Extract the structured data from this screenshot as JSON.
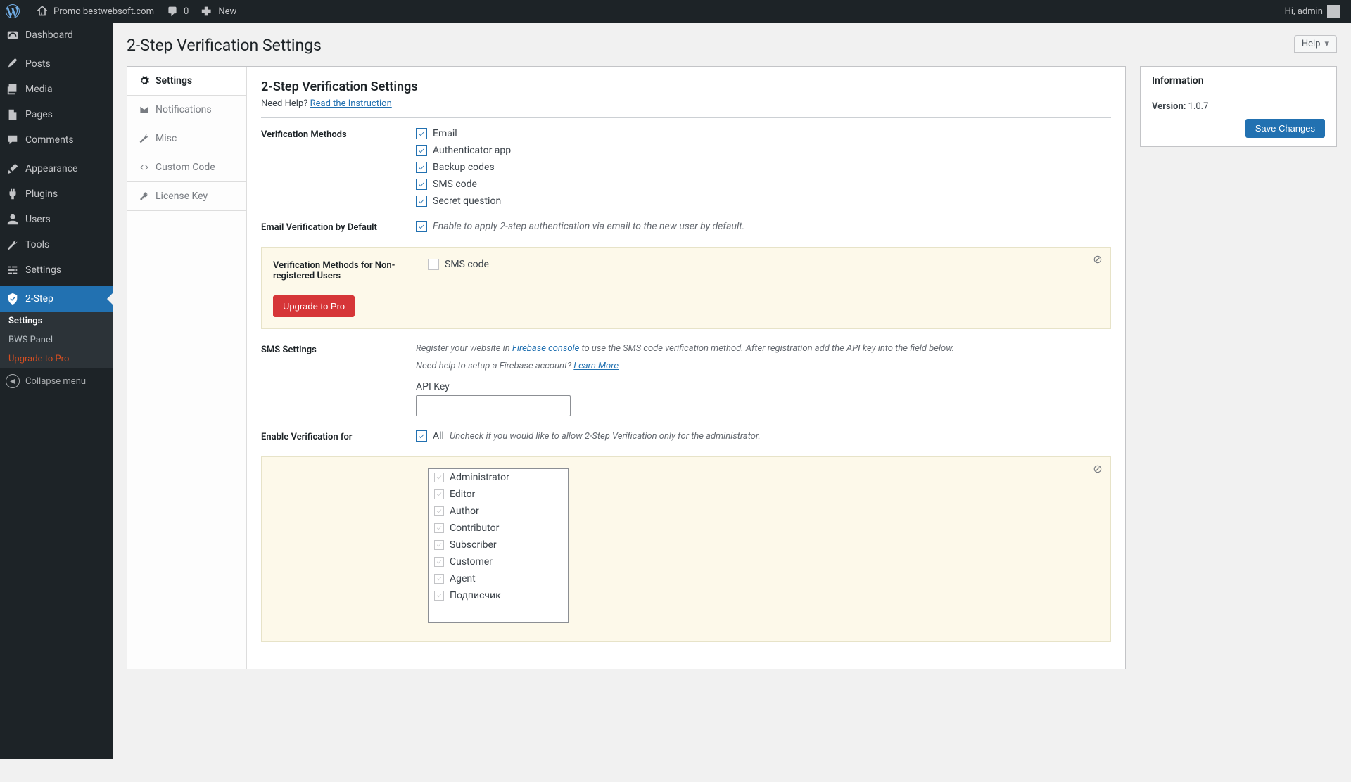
{
  "adminbar": {
    "site_name": "Promo bestwebsoft.com",
    "comments_count": "0",
    "new_label": "New",
    "greeting": "Hi, admin"
  },
  "sidebar": {
    "items": [
      {
        "label": "Dashboard",
        "icon": "dashboard"
      },
      {
        "label": "Posts",
        "icon": "pin"
      },
      {
        "label": "Media",
        "icon": "media"
      },
      {
        "label": "Pages",
        "icon": "page"
      },
      {
        "label": "Comments",
        "icon": "comment"
      },
      {
        "label": "Appearance",
        "icon": "brush"
      },
      {
        "label": "Plugins",
        "icon": "plug"
      },
      {
        "label": "Users",
        "icon": "user"
      },
      {
        "label": "Tools",
        "icon": "wrench"
      },
      {
        "label": "Settings",
        "icon": "sliders"
      },
      {
        "label": "2-Step",
        "icon": "shield",
        "current": true
      }
    ],
    "submenu": [
      {
        "label": "Settings",
        "current": true
      },
      {
        "label": "BWS Panel"
      },
      {
        "label": "Upgrade to Pro",
        "upgrade": true
      }
    ],
    "collapse_label": "Collapse menu"
  },
  "page": {
    "title": "2-Step Verification Settings",
    "help_label": "Help"
  },
  "tabs": [
    {
      "label": "Settings",
      "icon": "gear",
      "active": true
    },
    {
      "label": "Notifications",
      "icon": "mail"
    },
    {
      "label": "Misc",
      "icon": "wrench"
    },
    {
      "label": "Custom Code",
      "icon": "code"
    },
    {
      "label": "License Key",
      "icon": "key"
    }
  ],
  "settings": {
    "section_title": "2-Step Verification Settings",
    "need_help_prefix": "Need Help? ",
    "need_help_link": "Read the Instruction",
    "methods_label": "Verification Methods",
    "methods": [
      "Email",
      "Authenticator app",
      "Backup codes",
      "SMS code",
      "Secret question"
    ],
    "email_default_label": "Email Verification by Default",
    "email_default_hint": "Enable to apply 2-step authentication via email to the new user by default.",
    "nonreg_label": "Verification Methods for Non-registered Users",
    "nonreg_method": "SMS code",
    "upgrade_btn": "Upgrade to Pro",
    "sms_label": "SMS Settings",
    "sms_register_prefix": "Register your website in ",
    "sms_firebase_link": "Firebase console",
    "sms_register_suffix": " to use the SMS code verification method. After registration add the API key into the field below.",
    "sms_firebase_help_prefix": "Need help to setup a Firebase account? ",
    "sms_learn_more": "Learn More",
    "api_key_label": "API Key",
    "enable_for_label": "Enable Verification for",
    "enable_all_label": "All",
    "enable_all_hint": "Uncheck if you would like to allow 2-Step Verification only for the administrator.",
    "roles": [
      "Administrator",
      "Editor",
      "Author",
      "Contributor",
      "Subscriber",
      "Customer",
      "Agent",
      "Подписчик"
    ]
  },
  "info": {
    "title": "Information",
    "version_label": "Version:",
    "version_value": "1.0.7",
    "save_btn": "Save Changes"
  }
}
